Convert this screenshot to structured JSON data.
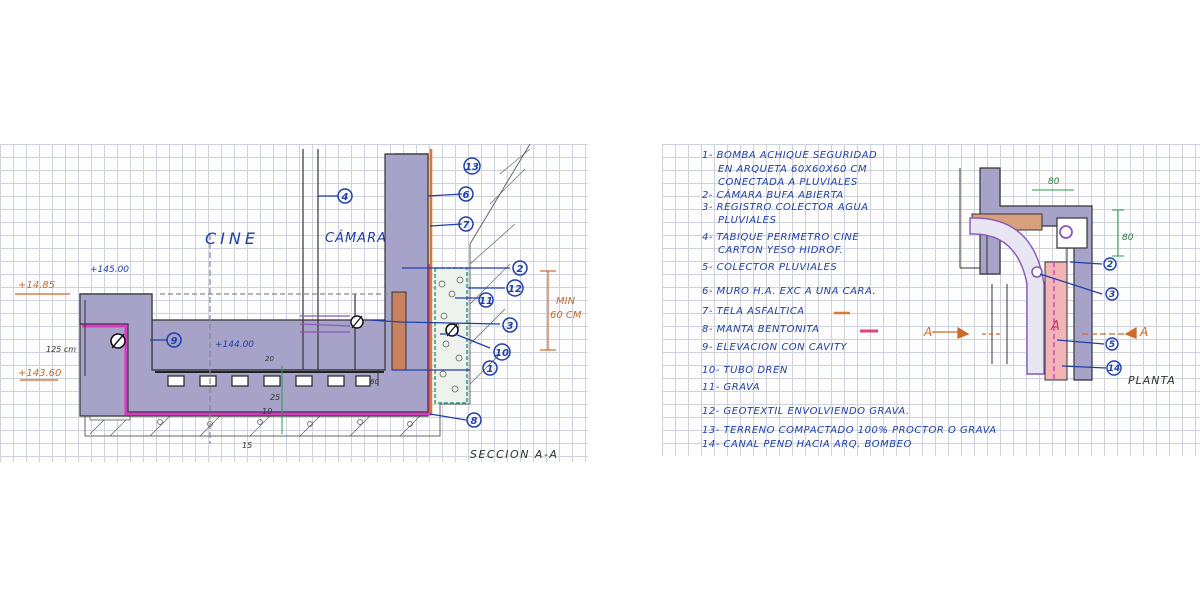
{
  "left_sheet": {
    "room_labels": {
      "cine": "CINE",
      "camara": "CÁMARA"
    },
    "levels": {
      "top_left": "+14.85",
      "top_mid": "+145.00",
      "floor": "+144.00",
      "bottom_left": "+143.60",
      "height_125": "125 cm"
    },
    "dimensions": {
      "d25": "25",
      "d10": "10",
      "d15": "15",
      "d20": "20",
      "d60": "60",
      "min": "MIN",
      "min_cm": "60 CM"
    },
    "callouts": [
      "4",
      "6",
      "7",
      "13",
      "2",
      "12",
      "11",
      "3",
      "10",
      "1",
      "8",
      "9"
    ],
    "pipe_symbol": "Ø",
    "caption": "SECCION A-A"
  },
  "right_sheet": {
    "legend": [
      "1- BOMBA ACHIQUE SEGURIDAD",
      "EN ARQUETA 60X60X60 CM",
      "CONECTADA A PLUVIALES",
      "2- CÁMARA BUFA ABIERTA",
      "3- REGISTRO COLECTOR AGUA",
      "PLUVIALES",
      "4- TABIQUE PERIMETRO CINE",
      "CARTON YESO HIDROF.",
      "5- COLECTOR PLUVIALES",
      "6- MURO H.A. EXC A UNA CARA.",
      "7- TELA ASFALTICA",
      "8- MANTA BENTONITA",
      "9- ELEVACION CON CAVITY",
      "10- TUBO DREN",
      "11- GRAVA",
      "12- GEOTEXTIL ENVOLVIENDO GRAVA.",
      "13- TERRENO COMPACTADO 100% PROCTOR O GRAVA",
      "14- CANAL PEND HACIA ARQ. BOMBEO"
    ],
    "plan_dims": {
      "d80_top": "80",
      "d80_side": "80"
    },
    "section_marks": {
      "left": "A",
      "right": "A",
      "center": "A"
    },
    "callouts": [
      "2",
      "3",
      "5",
      "14"
    ],
    "caption": "PLANTA"
  },
  "colors": {
    "wall_purple": "#a7a3c8",
    "membrane_magenta": "#d63bc0",
    "asphalt_orange": "#d9782e",
    "ink_blue": "#1f3fa8",
    "gravel_green": "#2a9a80",
    "channel_pink": "#f2b5b5"
  }
}
